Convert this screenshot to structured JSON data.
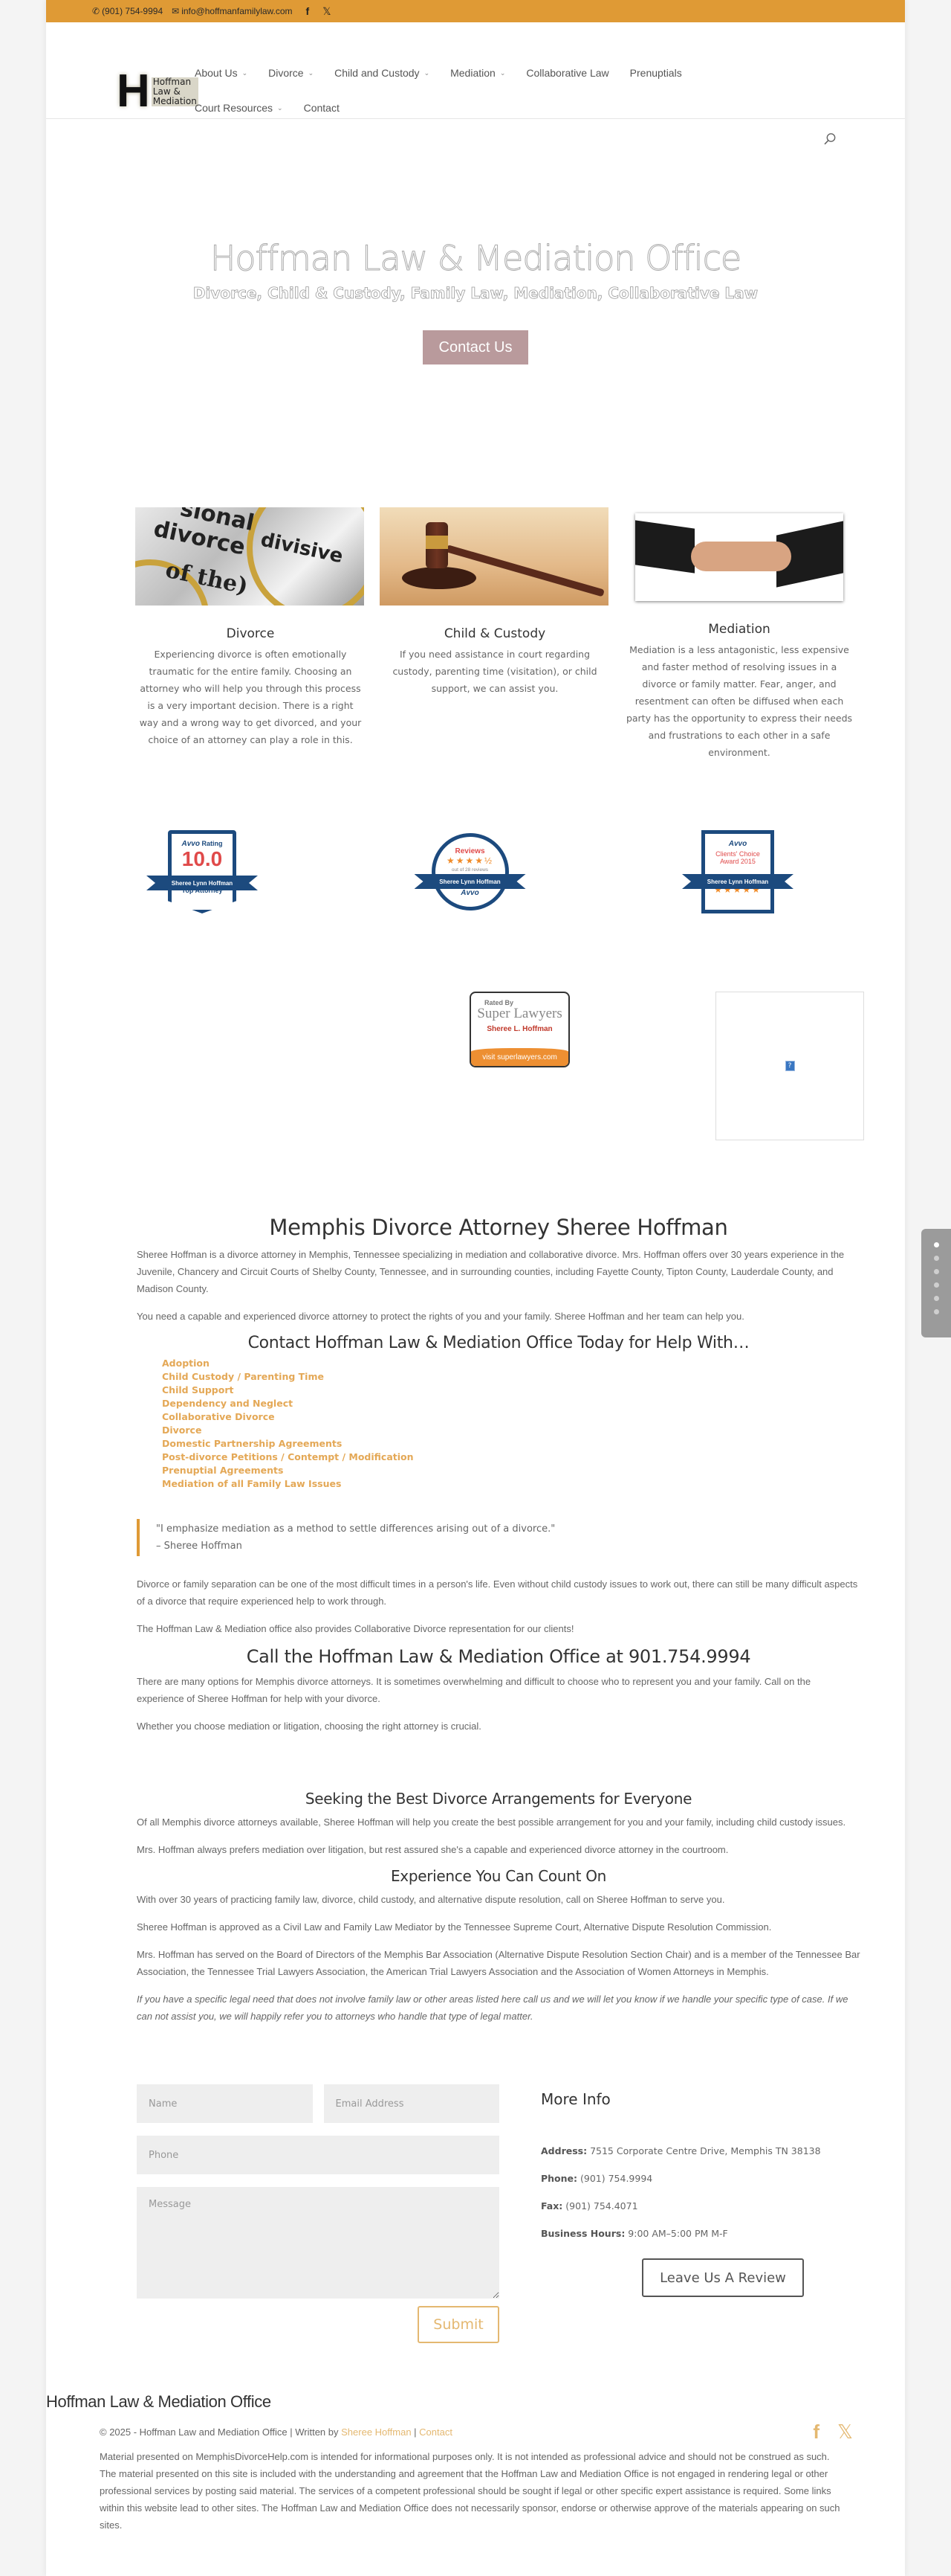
{
  "topbar": {
    "phone": "(901) 754-9994",
    "email": "info@hoffmanfamilylaw.com",
    "social": [
      "facebook",
      "x-twitter"
    ]
  },
  "logo": {
    "letter": "H",
    "lines": [
      "Hoffman",
      "Law &",
      "Mediation"
    ]
  },
  "nav": {
    "row1": [
      {
        "label": "About Us",
        "dropdown": true
      },
      {
        "label": "Divorce",
        "dropdown": true
      },
      {
        "label": "Child and Custody",
        "dropdown": true
      },
      {
        "label": "Mediation",
        "dropdown": true
      },
      {
        "label": "Collaborative Law",
        "dropdown": false
      },
      {
        "label": "Prenuptials",
        "dropdown": false
      }
    ],
    "row2": [
      {
        "label": "Court Resources",
        "dropdown": true
      },
      {
        "label": "Contact",
        "dropdown": false
      }
    ],
    "chevron": "⌄",
    "search_icon": "search-icon"
  },
  "hero": {
    "title": "Hoffman Law & Mediation Office",
    "subtitle": "Divorce, Child & Custody, Family Law, Mediation, Collaborative Law",
    "button": "Contact Us",
    "button_color": "#b99a9c"
  },
  "services": [
    {
      "title": "Divorce",
      "text": "Experiencing divorce is often emotionally traumatic for the entire family. Choosing an attorney who will help you through this process is a very important decision. There is a right way and a wrong way to get divorced, and your choice of an attorney can play a role in this.",
      "image_words": [
        "slonal",
        "divorce",
        "divisive",
        "of the)"
      ]
    },
    {
      "title": "Child & Custody",
      "text": "If you need assistance in court regarding custody, parenting time (visitation), or child support, we can assist you."
    },
    {
      "title": "Mediation",
      "text": "Mediation is a less antagonistic, less expensive and faster method of resolving issues in a divorce or family matter. Fear, anger, and resentment can often be diffused when each party has the opportunity to express their needs and frustrations to each other in a safe environment."
    }
  ],
  "badges": {
    "avvo_rating": {
      "brand": "Avvo",
      "label": "Rating",
      "score": "10.0",
      "name": "Sheree Lynn Hoffman",
      "caption": "Top Attorney"
    },
    "avvo_reviews": {
      "title": "Reviews",
      "stars": "★★★★½",
      "rating": 4.5,
      "count_text": "out of 28 reviews",
      "name": "Sheree Lynn Hoffman",
      "brand": "Avvo"
    },
    "avvo_clients": {
      "brand": "Avvo",
      "line1": "Clients' Choice",
      "line2": "Award 2015",
      "name": "Sheree Lynn Hoffman",
      "stars": "★★★★★"
    },
    "super_lawyers": {
      "rated_by": "Rated By",
      "brand": "Super Lawyers",
      "name": "Sheree L. Hoffman",
      "visit": "visit superlawyers.com"
    },
    "broken_image": "?"
  },
  "content": {
    "h1": "Memphis Divorce Attorney Sheree Hoffman",
    "p1": "Sheree Hoffman is a divorce attorney in Memphis, Tennessee specializing in mediation and collaborative divorce. Mrs. Hoffman offers over 30 years experience in the Juvenile, Chancery and Circuit Courts of Shelby County, Tennessee, and in surrounding counties, including Fayette County, Tipton County, Lauderdale County, and Madison County.",
    "p2": "You need a capable and experienced divorce attorney to protect the rights of you and your family. Sheree Hoffman and her team can help you.",
    "h2_help": "Contact Hoffman Law & Mediation Office Today for Help With…",
    "help_list": [
      "Adoption",
      "Child Custody / Parenting Time",
      "Child Support",
      "Dependency and Neglect",
      "Collaborative Divorce",
      "Divorce",
      "Domestic Partnership Agreements",
      "Post-divorce Petitions / Contempt / Modification",
      "Prenuptial Agreements",
      "Mediation of all Family Law Issues"
    ],
    "quote": "\"I emphasize mediation as a method to settle differences arising out of a divorce.\"",
    "quote_author": "– Sheree Hoffman",
    "p3": "Divorce or family separation can be one of the most difficult times in a person's life. Even without child custody issues to work out, there can still be many difficult aspects of a divorce that require experienced help to work through.",
    "p4": "The Hoffman Law & Mediation office also provides Collaborative Divorce representation for our clients!",
    "h2_call": "Call the Hoffman Law & Mediation Office at 901.754.9994",
    "p5": "There are many options for Memphis divorce attorneys. It is sometimes overwhelming and difficult to choose who to represent you and your family. Call on the experience of Sheree Hoffman for help with your divorce.",
    "p6": "Whether you choose mediation or litigation, choosing the right attorney is crucial.",
    "h2_seek": "Seeking the Best Divorce Arrangements for Everyone",
    "p7": "Of all Memphis divorce attorneys available, Sheree Hoffman will help you create the best possible arrangement for you and your family, including child custody issues.",
    "p8": "Mrs. Hoffman always prefers mediation over litigation, but rest assured she's a capable and experienced divorce attorney in the courtroom.",
    "h2_exp": "Experience You Can Count On",
    "p9": "With over 30 years of practicing family law, divorce, child custody, and alternative dispute resolution, call on Sheree Hoffman to serve you.",
    "p10": "Sheree Hoffman is approved as a Civil Law and Family Law Mediator by the Tennessee Supreme Court, Alternative Dispute Resolution Commission.",
    "p11": "Mrs. Hoffman has served on the Board of Directors of the Memphis Bar Association (Alternative Dispute Resolution Section Chair) and is a member of the Tennessee Bar Association, the Tennessee Trial Lawyers Association, the American Trial Lawyers Association and the Association of Women Attorneys in Memphis.",
    "p12": "If you have a specific legal need that does not involve family law or other areas listed here call us and we will let you know if we handle your specific type of case. If we can not assist you, we will happily refer you to attorneys who handle that type of legal matter."
  },
  "form": {
    "name_placeholder": "Name",
    "email_placeholder": "Email Address",
    "phone_placeholder": "Phone",
    "message_placeholder": "Message",
    "submit": "Submit"
  },
  "info": {
    "title": "More Info",
    "address_label": "Address:",
    "address": "7515 Corporate Centre Drive, Memphis TN 38138",
    "phone_label": "Phone:",
    "phone": "(901) 754.9994",
    "fax_label": "Fax:",
    "fax": "(901) 754.4071",
    "hours_label": "Business Hours:",
    "hours": "9:00 AM–5:00 PM M-F",
    "review_button": "Leave Us A Review"
  },
  "footer": {
    "title": "Hoffman Law & Mediation Office",
    "copy_prefix": "© 2025 - Hoffman Law and Mediation Office | Written by ",
    "author_link": "Sheree Hoffman",
    "sep": " | ",
    "contact_link": "Contact",
    "disclaimer": "Material presented on MemphisDivorceHelp.com is intended for informational purposes only. It is not intended as professional advice and should not be construed as such. The material presented on this site is included with the understanding and agreement that the Hoffman Law and Mediation Office is not engaged in rendering legal or other professional services by posting said material. The services of a competent professional should be sought if legal or other specific expert assistance is required. Some links within this website lead to other sites. The Hoffman Law and Mediation Office does not necessarily sponsor, endorse or otherwise approve of the materials appearing on such sites.",
    "social": [
      "facebook",
      "x-twitter"
    ]
  },
  "side_nav": {
    "dots": 6,
    "active": 0
  },
  "colors": {
    "accent": "#df9a35",
    "link": "#e4a856",
    "avvo_blue": "#1c4a7e",
    "avvo_red": "#e04a4a"
  }
}
